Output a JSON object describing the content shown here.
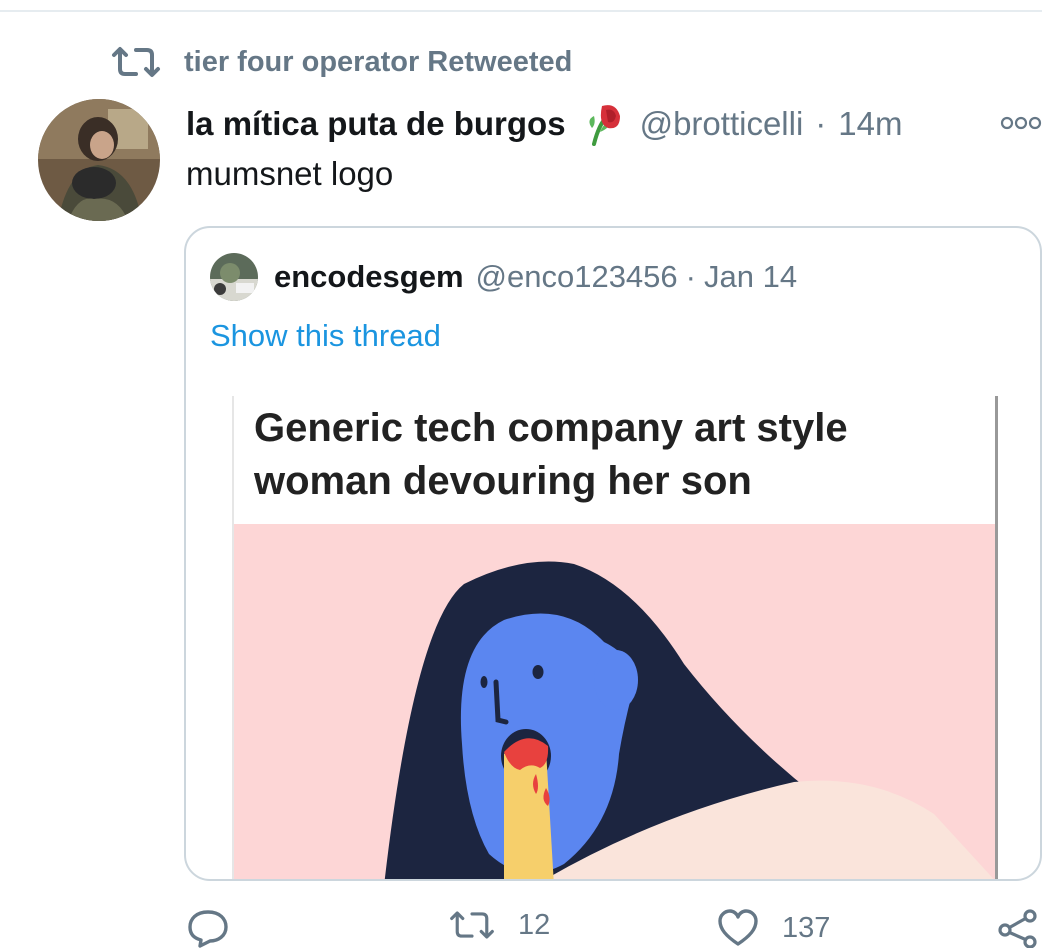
{
  "retweet_context": {
    "text": "tier four operator Retweeted",
    "icon": "retweet-icon"
  },
  "tweet": {
    "author_name": "la mítica puta de burgos",
    "author_emoji": "wilted-rose-emoji",
    "handle": "@brotticelli",
    "separator": "·",
    "time": "14m",
    "text": "mumsnet logo"
  },
  "quoted_tweet": {
    "author_name": "encodesgem",
    "handle": "@enco123456",
    "separator": "·",
    "date": "Jan 14",
    "show_thread": "Show this thread",
    "image": {
      "caption": "Generic tech company art style woman devouring her son"
    }
  },
  "actions": {
    "reply": {
      "icon": "reply-icon",
      "count": ""
    },
    "retweet": {
      "icon": "retweet-icon",
      "count": "12"
    },
    "like": {
      "icon": "heart-icon",
      "count": "137"
    },
    "share": {
      "icon": "share-icon"
    }
  },
  "colors": {
    "secondary_text": "#657786",
    "link": "#1b95e0",
    "border": "#ccd6dd",
    "meme_background": "#fdd6d6",
    "face_blue": "#5b86f0",
    "hair_navy": "#1c2540"
  }
}
